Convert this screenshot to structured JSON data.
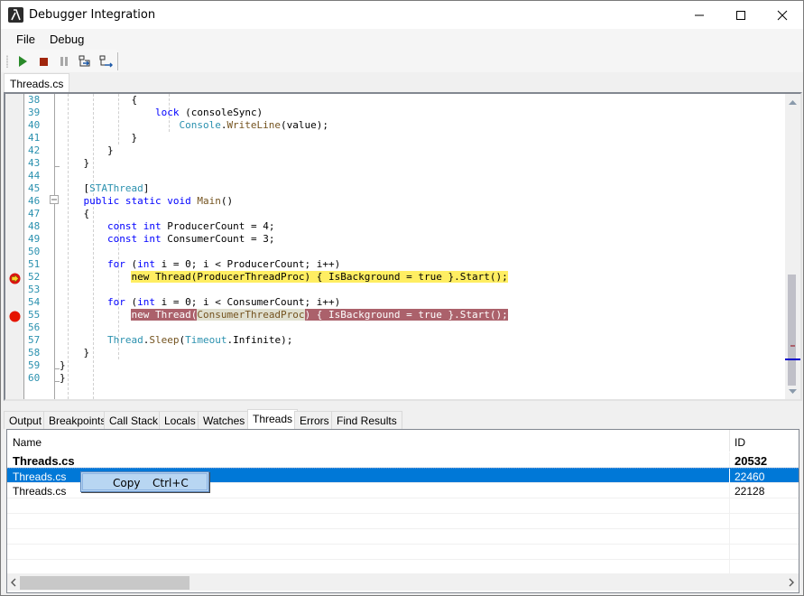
{
  "window": {
    "title": "Debugger Integration"
  },
  "menu": {
    "items": [
      {
        "label": "File"
      },
      {
        "label": "Debug"
      }
    ]
  },
  "toolbar": {
    "buttons": [
      {
        "icon": "play-icon",
        "label": "Continue"
      },
      {
        "icon": "stop-icon",
        "label": "Stop"
      },
      {
        "icon": "pause-icon",
        "label": "Pause"
      },
      {
        "icon": "step-into-icon",
        "label": "Step Into"
      },
      {
        "icon": "step-over-icon",
        "label": "Step Over"
      }
    ],
    "colors": {
      "play": "#2a8a2a",
      "stop": "#a1260d",
      "pause": "#a8a8a8",
      "step": "#1e5aa8"
    }
  },
  "document_tabs": [
    {
      "label": "Threads.cs",
      "active": true
    }
  ],
  "editor": {
    "line_numbers": [
      "38",
      "39",
      "40",
      "41",
      "42",
      "43",
      "44",
      "45",
      "46",
      "47",
      "48",
      "49",
      "50",
      "51",
      "52",
      "53",
      "54",
      "55",
      "56",
      "57",
      "58",
      "59",
      "60"
    ],
    "lines": [
      "            {",
      "                lock (consoleSync)",
      "                    Console.WriteLine(value);",
      "            }",
      "        }",
      "    }",
      "",
      "    [STAThread]",
      "    public static void Main()",
      "    {",
      "        const int ProducerCount = 4;",
      "        const int ConsumerCount = 3;",
      "",
      "        for (int i = 0; i < ProducerCount; i++)",
      "            new Thread(ProducerThreadProc) { IsBackground = true }.Start();",
      "",
      "        for (int i = 0; i < ConsumerCount; i++)",
      "            new Thread(ConsumerThreadProc) { IsBackground = true }.Start();",
      "",
      "        Thread.Sleep(Timeout.Infinite);",
      "    }",
      "}",
      "}"
    ],
    "current_line": "52",
    "breakpoint_line": "55",
    "colors": {
      "current_statement": "#ffee62",
      "breakpoint": "#ab616b",
      "keyword": "#0000ff",
      "type": "#2b91af",
      "method": "#74531f",
      "line_number": "#2b91af"
    }
  },
  "panel": {
    "tabs": [
      {
        "label": "Output"
      },
      {
        "label": "Breakpoints"
      },
      {
        "label": "Call Stack"
      },
      {
        "label": "Locals"
      },
      {
        "label": "Watches"
      },
      {
        "label": "Threads",
        "active": true
      },
      {
        "label": "Errors"
      },
      {
        "label": "Find Results"
      }
    ],
    "threads": {
      "columns": [
        "Name",
        "ID"
      ],
      "rows": [
        {
          "name": "Threads.cs",
          "id": "20532",
          "bold": true
        },
        {
          "name": "Threads.cs",
          "id": "22460",
          "selected": true
        },
        {
          "name": "Threads.cs",
          "id": "22128"
        }
      ]
    }
  },
  "context_menu": {
    "items": [
      {
        "label": "Copy",
        "shortcut": "Ctrl+C"
      }
    ]
  }
}
